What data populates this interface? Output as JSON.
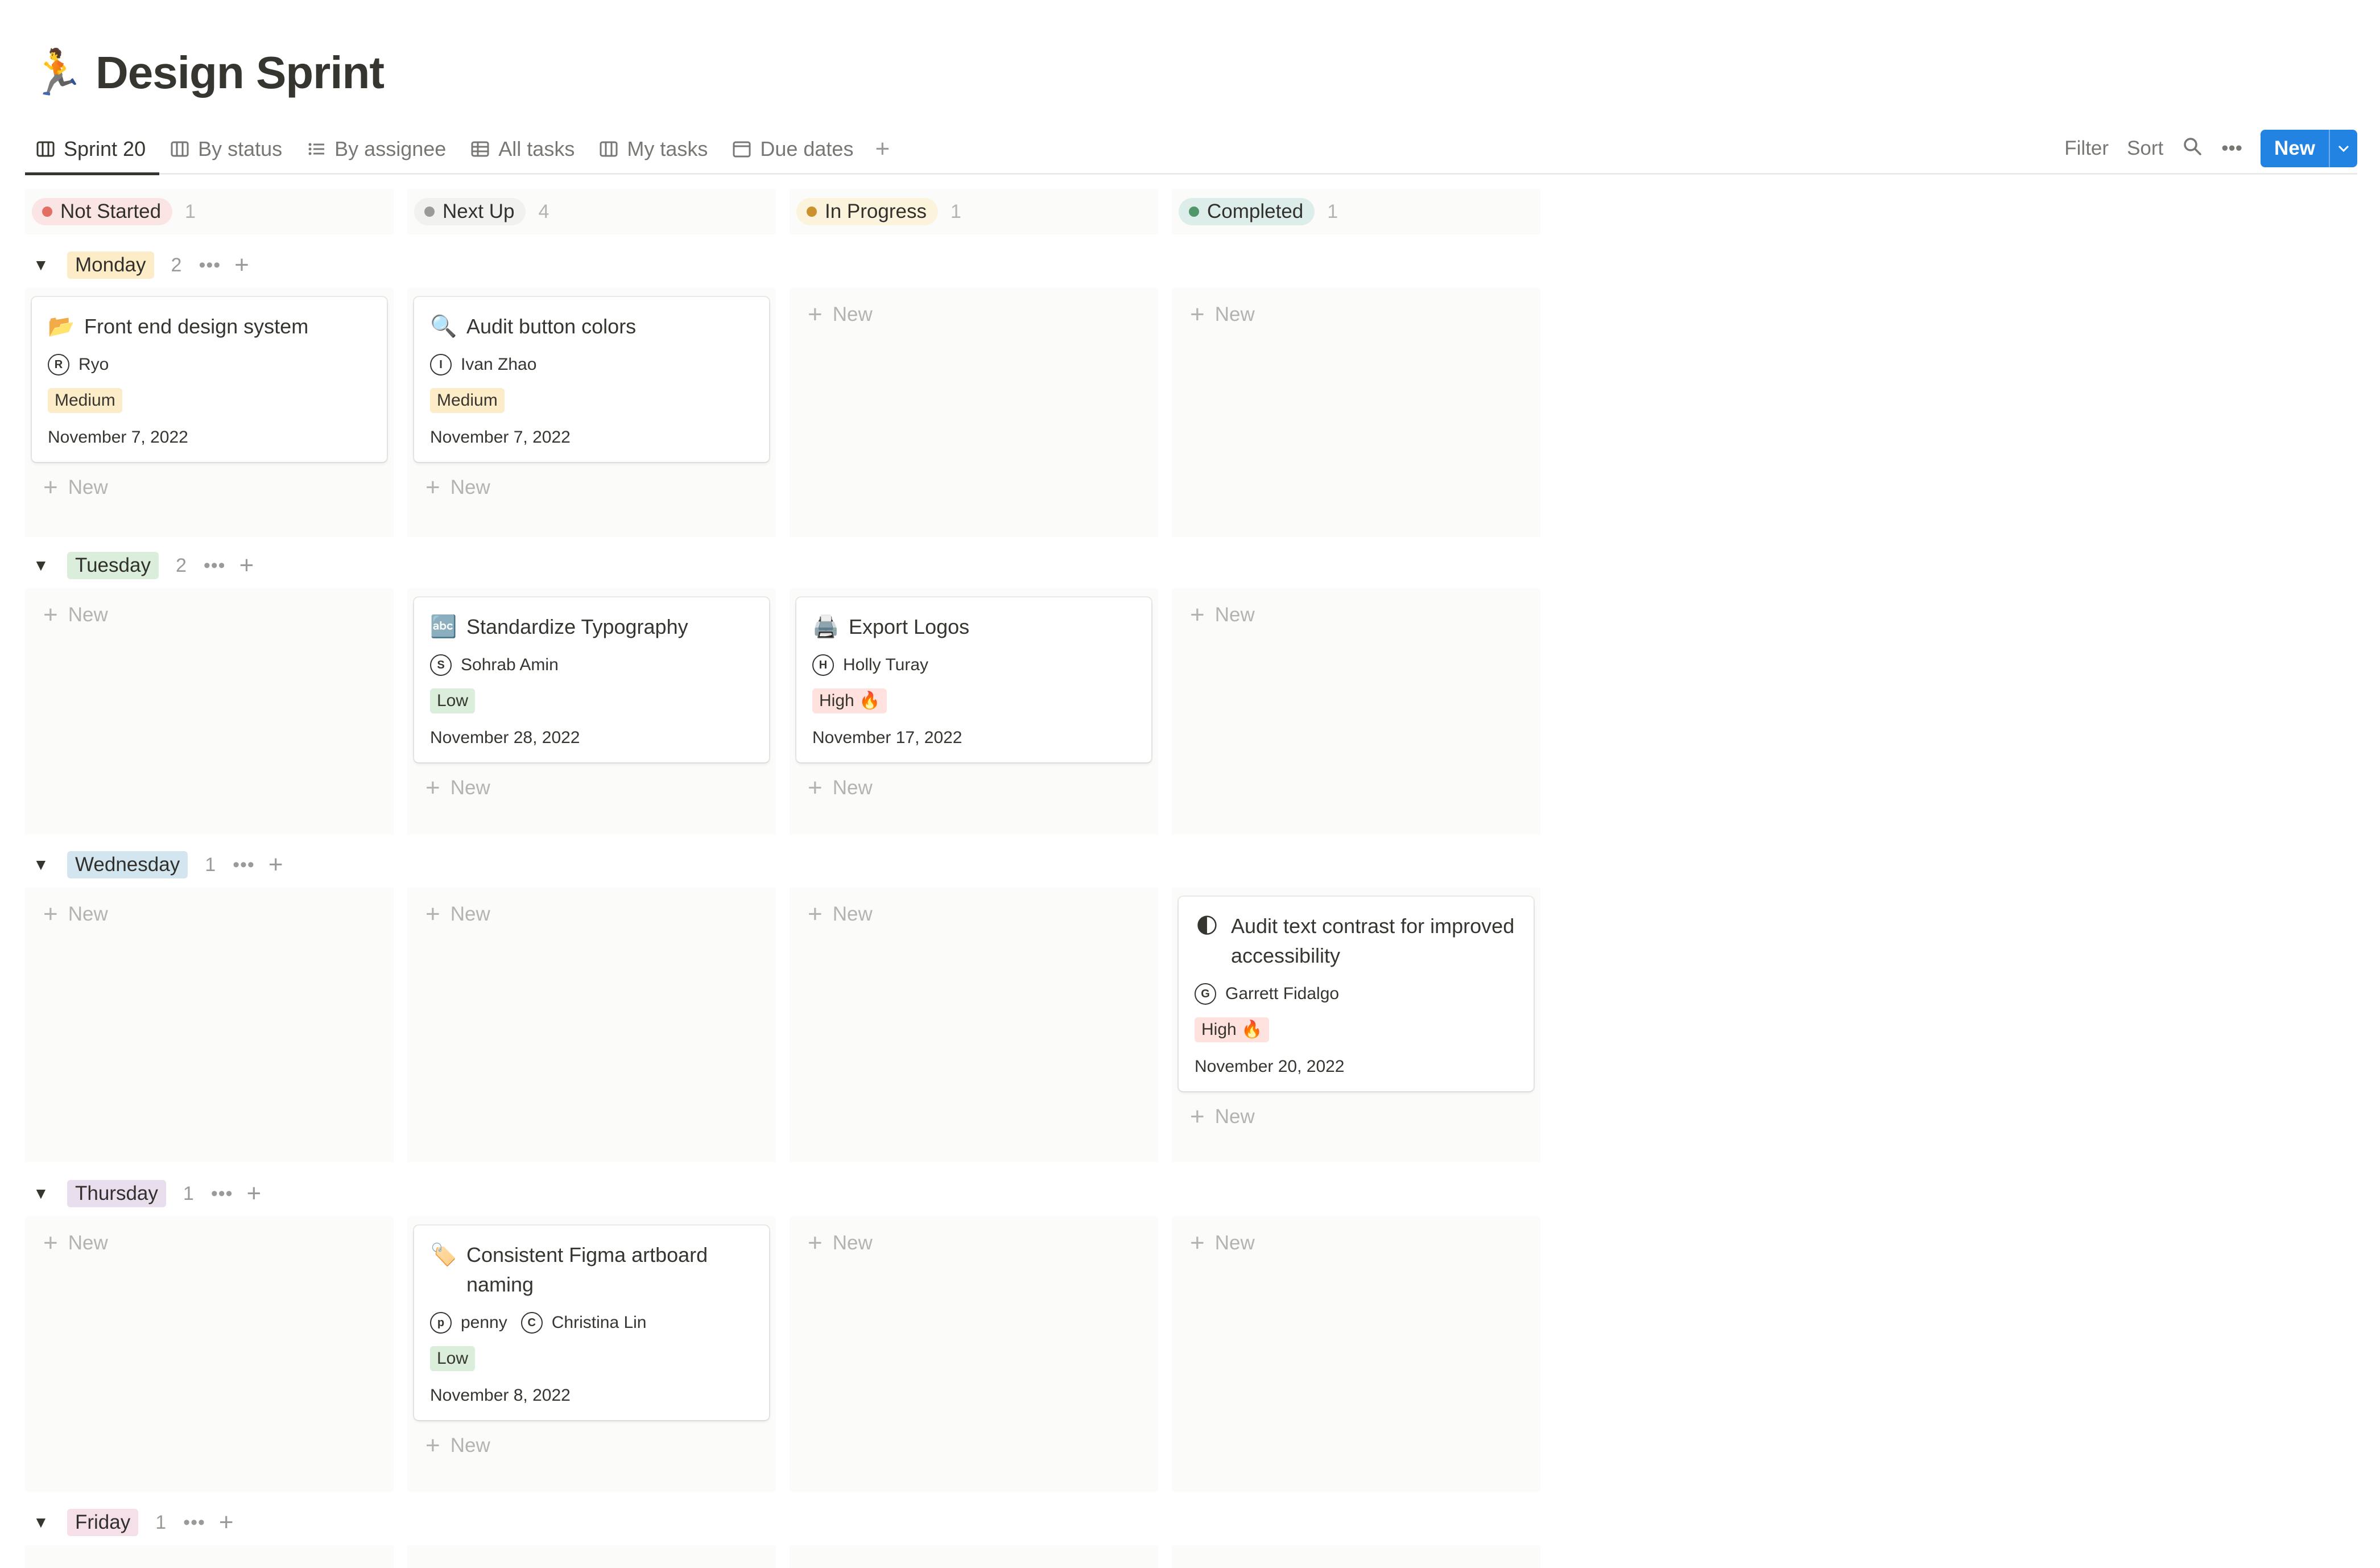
{
  "page": {
    "icon": "🏃",
    "title": "Design Sprint"
  },
  "tabs": [
    {
      "label": "Sprint 20",
      "icon": "board-icon",
      "active": true
    },
    {
      "label": "By status",
      "icon": "board-icon"
    },
    {
      "label": "By assignee",
      "icon": "list-icon"
    },
    {
      "label": "All tasks",
      "icon": "table-icon"
    },
    {
      "label": "My tasks",
      "icon": "board-icon"
    },
    {
      "label": "Due dates",
      "icon": "calendar-icon"
    }
  ],
  "toolbar": {
    "filter": "Filter",
    "sort": "Sort",
    "new_label": "New",
    "more": "•••"
  },
  "columns": [
    {
      "label": "Not Started",
      "count": "1",
      "bg": "#fbe4e4",
      "dot": "#e16f64"
    },
    {
      "label": "Next Up",
      "count": "4",
      "bg": "#f1f1ef",
      "dot": "#9b9a97"
    },
    {
      "label": "In Progress",
      "count": "1",
      "bg": "#fbf3db",
      "dot": "#cb912f"
    },
    {
      "label": "Completed",
      "count": "1",
      "bg": "#ddedea",
      "dot": "#4f9768"
    }
  ],
  "new_label": "New",
  "groups": [
    {
      "label": "Monday",
      "count": "2",
      "bg": "#fdecc8"
    },
    {
      "label": "Tuesday",
      "count": "2",
      "bg": "#dbeddb"
    },
    {
      "label": "Wednesday",
      "count": "1",
      "bg": "#d3e5ef"
    },
    {
      "label": "Thursday",
      "count": "1",
      "bg": "#e8deee"
    },
    {
      "label": "Friday",
      "count": "1",
      "bg": "#f5e0e9"
    }
  ],
  "cards": {
    "mon_ns": {
      "icon": "📂",
      "title": "Front end design system",
      "person": "Ryo",
      "priority": "Medium",
      "date": "November 7, 2022"
    },
    "mon_nu": {
      "icon": "🔍",
      "title": "Audit button colors",
      "person": "Ivan Zhao",
      "priority": "Medium",
      "date": "November 7, 2022"
    },
    "tue_nu": {
      "icon": "🔤",
      "title": "Standardize Typography",
      "person": "Sohrab Amin",
      "priority": "Low",
      "date": "November 28, 2022"
    },
    "tue_ip": {
      "icon": "🖨️",
      "title": "Export Logos",
      "person": "Holly Turay",
      "priority": "High 🔥",
      "date": "November 17, 2022"
    },
    "wed_c": {
      "icon": "🌓",
      "title": "Audit text contrast for improved accessibility",
      "person": "Garrett Fidalgo",
      "priority": "High 🔥",
      "date": "November 20, 2022"
    },
    "thu_nu": {
      "icon": "🏷️",
      "title": "Consistent Figma artboard naming",
      "person": "penny",
      "person2": "Christina Lin",
      "priority": "Low",
      "date": "November 8, 2022"
    }
  },
  "priority_colors": {
    "Medium": "#fdecc8",
    "Low": "#dbeddb",
    "High": "#ffe2dd"
  }
}
